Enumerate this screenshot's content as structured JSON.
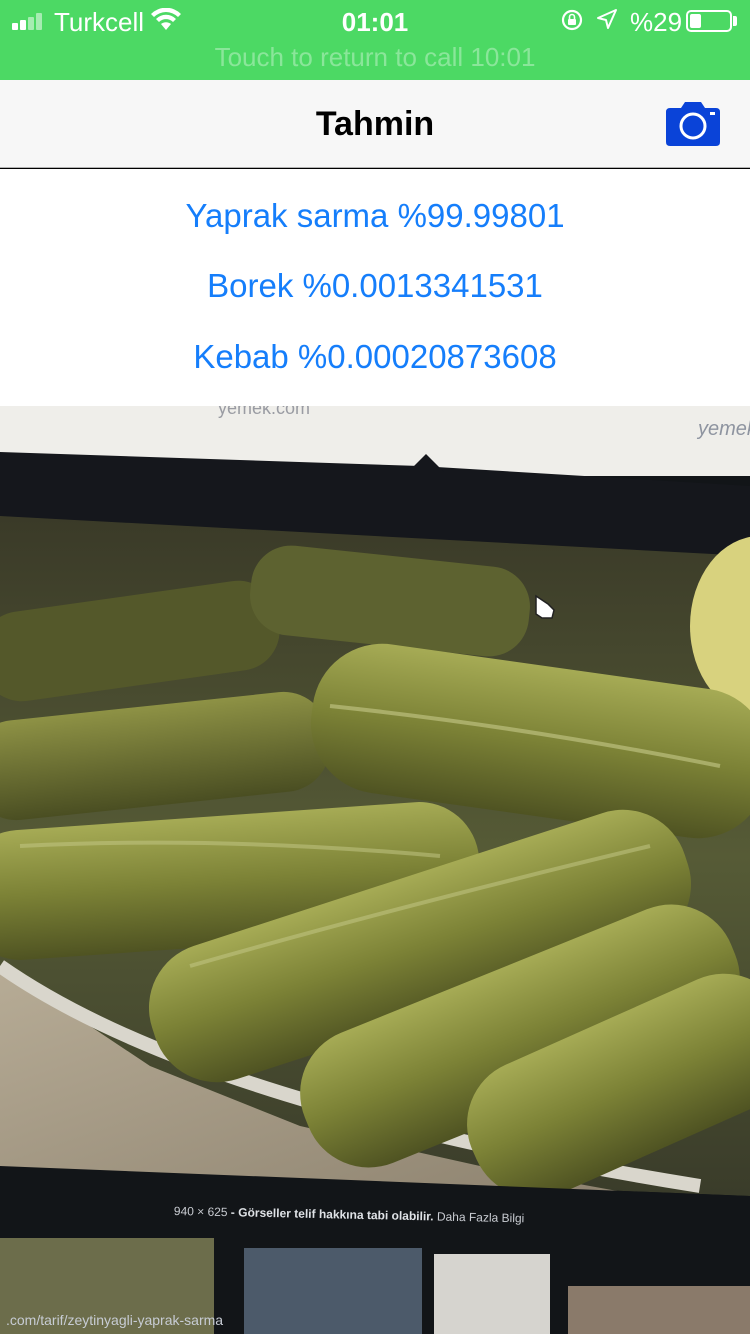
{
  "status_bar": {
    "carrier": "Turkcell",
    "time": "01:01",
    "battery_percent_label": "%29",
    "battery_level": 0.29,
    "call_banner": "Touch to return to call 10:01",
    "icons": [
      "signal-icon",
      "wifi-icon",
      "orientation-lock-icon",
      "location-icon",
      "battery-icon"
    ]
  },
  "nav": {
    "title": "Tahmin",
    "camera_icon": "camera-icon"
  },
  "predictions": [
    {
      "label": "Yaprak sarma %99.99801"
    },
    {
      "label": "Borek %0.0013341531"
    },
    {
      "label": "Kebab %0.00020873608"
    }
  ],
  "photo": {
    "screen_top_text_left": "yemek.com",
    "screen_top_text_right": "yemek",
    "caption_dimensions": "940 × 625",
    "caption_notice": " - Görseller telif hakkına tabi olabilir. ",
    "caption_link": "Daha Fazla Bilgi",
    "url_text": ".com/tarif/zeytinyagli-yaprak-sarma"
  },
  "colors": {
    "call_green": "#4cd964",
    "accent_blue": "#157efb",
    "camera_blue": "#0a43d8"
  }
}
